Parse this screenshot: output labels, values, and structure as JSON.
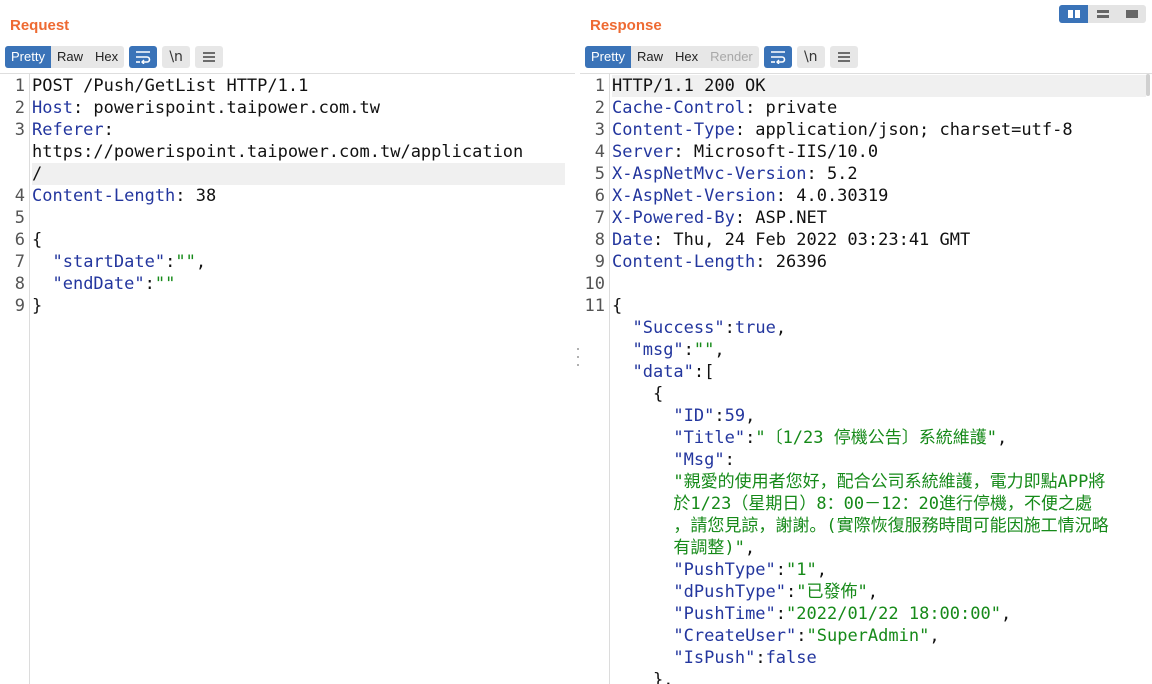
{
  "request": {
    "title": "Request",
    "tabs": [
      {
        "label": "Pretty",
        "active": true
      },
      {
        "label": "Raw",
        "active": false
      },
      {
        "label": "Hex",
        "active": false
      }
    ],
    "newline_label": "\\n",
    "lines": [
      {
        "num": "1",
        "parts": [
          {
            "t": "POST /Push/GetList HTTP/1.1",
            "c": "p"
          }
        ]
      },
      {
        "num": "2",
        "parts": [
          {
            "t": "Host",
            "c": "k"
          },
          {
            "t": ": powerispoint.taipower.com.tw",
            "c": "p"
          }
        ]
      },
      {
        "num": "3",
        "parts": [
          {
            "t": "Referer",
            "c": "k"
          },
          {
            "t": ":",
            "c": "p"
          }
        ]
      },
      {
        "num": "",
        "parts": [
          {
            "t": "https://powerispoint.taipower.com.tw/application",
            "c": "p"
          }
        ]
      },
      {
        "num": "",
        "parts": [
          {
            "t": "/",
            "c": "p"
          }
        ],
        "highlight": true
      },
      {
        "num": "4",
        "parts": [
          {
            "t": "Content-Length",
            "c": "k"
          },
          {
            "t": ": 38",
            "c": "p"
          }
        ]
      },
      {
        "num": "5",
        "parts": []
      },
      {
        "num": "6",
        "parts": [
          {
            "t": "{",
            "c": "p"
          }
        ]
      },
      {
        "num": "7",
        "parts": [
          {
            "t": "  ",
            "c": "p"
          },
          {
            "t": "\"startDate\"",
            "c": "k"
          },
          {
            "t": ":",
            "c": "p"
          },
          {
            "t": "\"\"",
            "c": "s"
          },
          {
            "t": ",",
            "c": "p"
          }
        ]
      },
      {
        "num": "8",
        "parts": [
          {
            "t": "  ",
            "c": "p"
          },
          {
            "t": "\"endDate\"",
            "c": "k"
          },
          {
            "t": ":",
            "c": "p"
          },
          {
            "t": "\"\"",
            "c": "s"
          }
        ]
      },
      {
        "num": "9",
        "parts": [
          {
            "t": "}",
            "c": "p"
          }
        ]
      }
    ]
  },
  "response": {
    "title": "Response",
    "tabs": [
      {
        "label": "Pretty",
        "active": true
      },
      {
        "label": "Raw",
        "active": false
      },
      {
        "label": "Hex",
        "active": false
      },
      {
        "label": "Render",
        "active": false,
        "disabled": true
      }
    ],
    "newline_label": "\\n",
    "lines": [
      {
        "num": "1",
        "parts": [
          {
            "t": "HTTP/1.1 200 OK",
            "c": "p"
          }
        ],
        "highlight": true
      },
      {
        "num": "2",
        "parts": [
          {
            "t": "Cache-Control",
            "c": "k"
          },
          {
            "t": ": private",
            "c": "p"
          }
        ]
      },
      {
        "num": "3",
        "parts": [
          {
            "t": "Content-Type",
            "c": "k"
          },
          {
            "t": ": application/json; charset=utf-8",
            "c": "p"
          }
        ]
      },
      {
        "num": "4",
        "parts": [
          {
            "t": "Server",
            "c": "k"
          },
          {
            "t": ": Microsoft-IIS/10.0",
            "c": "p"
          }
        ]
      },
      {
        "num": "5",
        "parts": [
          {
            "t": "X-AspNetMvc-Version",
            "c": "k"
          },
          {
            "t": ": 5.2",
            "c": "p"
          }
        ]
      },
      {
        "num": "6",
        "parts": [
          {
            "t": "X-AspNet-Version",
            "c": "k"
          },
          {
            "t": ": 4.0.30319",
            "c": "p"
          }
        ]
      },
      {
        "num": "7",
        "parts": [
          {
            "t": "X-Powered-By",
            "c": "k"
          },
          {
            "t": ": ASP.NET",
            "c": "p"
          }
        ]
      },
      {
        "num": "8",
        "parts": [
          {
            "t": "Date",
            "c": "k"
          },
          {
            "t": ": Thu, 24 Feb 2022 03:23:41 GMT",
            "c": "p"
          }
        ]
      },
      {
        "num": "9",
        "parts": [
          {
            "t": "Content-Length",
            "c": "k"
          },
          {
            "t": ": 26396",
            "c": "p"
          }
        ]
      },
      {
        "num": "10",
        "parts": []
      },
      {
        "num": "11",
        "parts": [
          {
            "t": "{",
            "c": "p"
          }
        ]
      },
      {
        "num": "",
        "parts": [
          {
            "t": "  ",
            "c": "p"
          },
          {
            "t": "\"Success\"",
            "c": "k"
          },
          {
            "t": ":",
            "c": "p"
          },
          {
            "t": "true",
            "c": "n"
          },
          {
            "t": ",",
            "c": "p"
          }
        ]
      },
      {
        "num": "",
        "parts": [
          {
            "t": "  ",
            "c": "p"
          },
          {
            "t": "\"msg\"",
            "c": "k"
          },
          {
            "t": ":",
            "c": "p"
          },
          {
            "t": "\"\"",
            "c": "s"
          },
          {
            "t": ",",
            "c": "p"
          }
        ]
      },
      {
        "num": "",
        "parts": [
          {
            "t": "  ",
            "c": "p"
          },
          {
            "t": "\"data\"",
            "c": "k"
          },
          {
            "t": ":[",
            "c": "p"
          }
        ]
      },
      {
        "num": "",
        "parts": [
          {
            "t": "    {",
            "c": "p"
          }
        ]
      },
      {
        "num": "",
        "parts": [
          {
            "t": "      ",
            "c": "p"
          },
          {
            "t": "\"ID\"",
            "c": "k"
          },
          {
            "t": ":",
            "c": "p"
          },
          {
            "t": "59",
            "c": "n"
          },
          {
            "t": ",",
            "c": "p"
          }
        ]
      },
      {
        "num": "",
        "parts": [
          {
            "t": "      ",
            "c": "p"
          },
          {
            "t": "\"Title\"",
            "c": "k"
          },
          {
            "t": ":",
            "c": "p"
          },
          {
            "t": "\"〔1/23 停機公告〕系統維護\"",
            "c": "s"
          },
          {
            "t": ",",
            "c": "p"
          }
        ]
      },
      {
        "num": "",
        "parts": [
          {
            "t": "      ",
            "c": "p"
          },
          {
            "t": "\"Msg\"",
            "c": "k"
          },
          {
            "t": ":",
            "c": "p"
          }
        ]
      },
      {
        "num": "",
        "parts": [
          {
            "t": "      ",
            "c": "p"
          },
          {
            "t": "\"親愛的使用者您好，配合公司系統維護，電力即點APP將",
            "c": "s"
          }
        ]
      },
      {
        "num": "",
        "parts": [
          {
            "t": "      ",
            "c": "p"
          },
          {
            "t": "於1/23（星期日）8：00－12：20進行停機，不便之處",
            "c": "s"
          }
        ]
      },
      {
        "num": "",
        "parts": [
          {
            "t": "      ",
            "c": "p"
          },
          {
            "t": "，請您見諒，謝謝。(實際恢復服務時間可能因施工情況略",
            "c": "s"
          }
        ]
      },
      {
        "num": "",
        "parts": [
          {
            "t": "      ",
            "c": "p"
          },
          {
            "t": "有調整)\"",
            "c": "s"
          },
          {
            "t": ",",
            "c": "p"
          }
        ]
      },
      {
        "num": "",
        "parts": [
          {
            "t": "      ",
            "c": "p"
          },
          {
            "t": "\"PushType\"",
            "c": "k"
          },
          {
            "t": ":",
            "c": "p"
          },
          {
            "t": "\"1\"",
            "c": "s"
          },
          {
            "t": ",",
            "c": "p"
          }
        ]
      },
      {
        "num": "",
        "parts": [
          {
            "t": "      ",
            "c": "p"
          },
          {
            "t": "\"dPushType\"",
            "c": "k"
          },
          {
            "t": ":",
            "c": "p"
          },
          {
            "t": "\"已發佈\"",
            "c": "s"
          },
          {
            "t": ",",
            "c": "p"
          }
        ]
      },
      {
        "num": "",
        "parts": [
          {
            "t": "      ",
            "c": "p"
          },
          {
            "t": "\"PushTime\"",
            "c": "k"
          },
          {
            "t": ":",
            "c": "p"
          },
          {
            "t": "\"2022/01/22 18:00:00\"",
            "c": "s"
          },
          {
            "t": ",",
            "c": "p"
          }
        ]
      },
      {
        "num": "",
        "parts": [
          {
            "t": "      ",
            "c": "p"
          },
          {
            "t": "\"CreateUser\"",
            "c": "k"
          },
          {
            "t": ":",
            "c": "p"
          },
          {
            "t": "\"SuperAdmin\"",
            "c": "s"
          },
          {
            "t": ",",
            "c": "p"
          }
        ]
      },
      {
        "num": "",
        "parts": [
          {
            "t": "      ",
            "c": "p"
          },
          {
            "t": "\"IsPush\"",
            "c": "k"
          },
          {
            "t": ":",
            "c": "p"
          },
          {
            "t": "false",
            "c": "n"
          }
        ]
      },
      {
        "num": "",
        "parts": [
          {
            "t": "    },",
            "c": "p"
          }
        ]
      }
    ]
  },
  "icons": {
    "wrap": "word-wrap-icon",
    "newline": "newline-toggle-icon",
    "menu": "hamburger-menu-icon",
    "layout_side": "side-by-side-layout-icon",
    "layout_horizontal": "horizontal-layout-icon",
    "layout_vertical": "vertical-layout-icon"
  },
  "colors": {
    "title": "#ee6a32",
    "accent": "#3a73b8",
    "key": "#23369e",
    "string": "#168a19"
  }
}
